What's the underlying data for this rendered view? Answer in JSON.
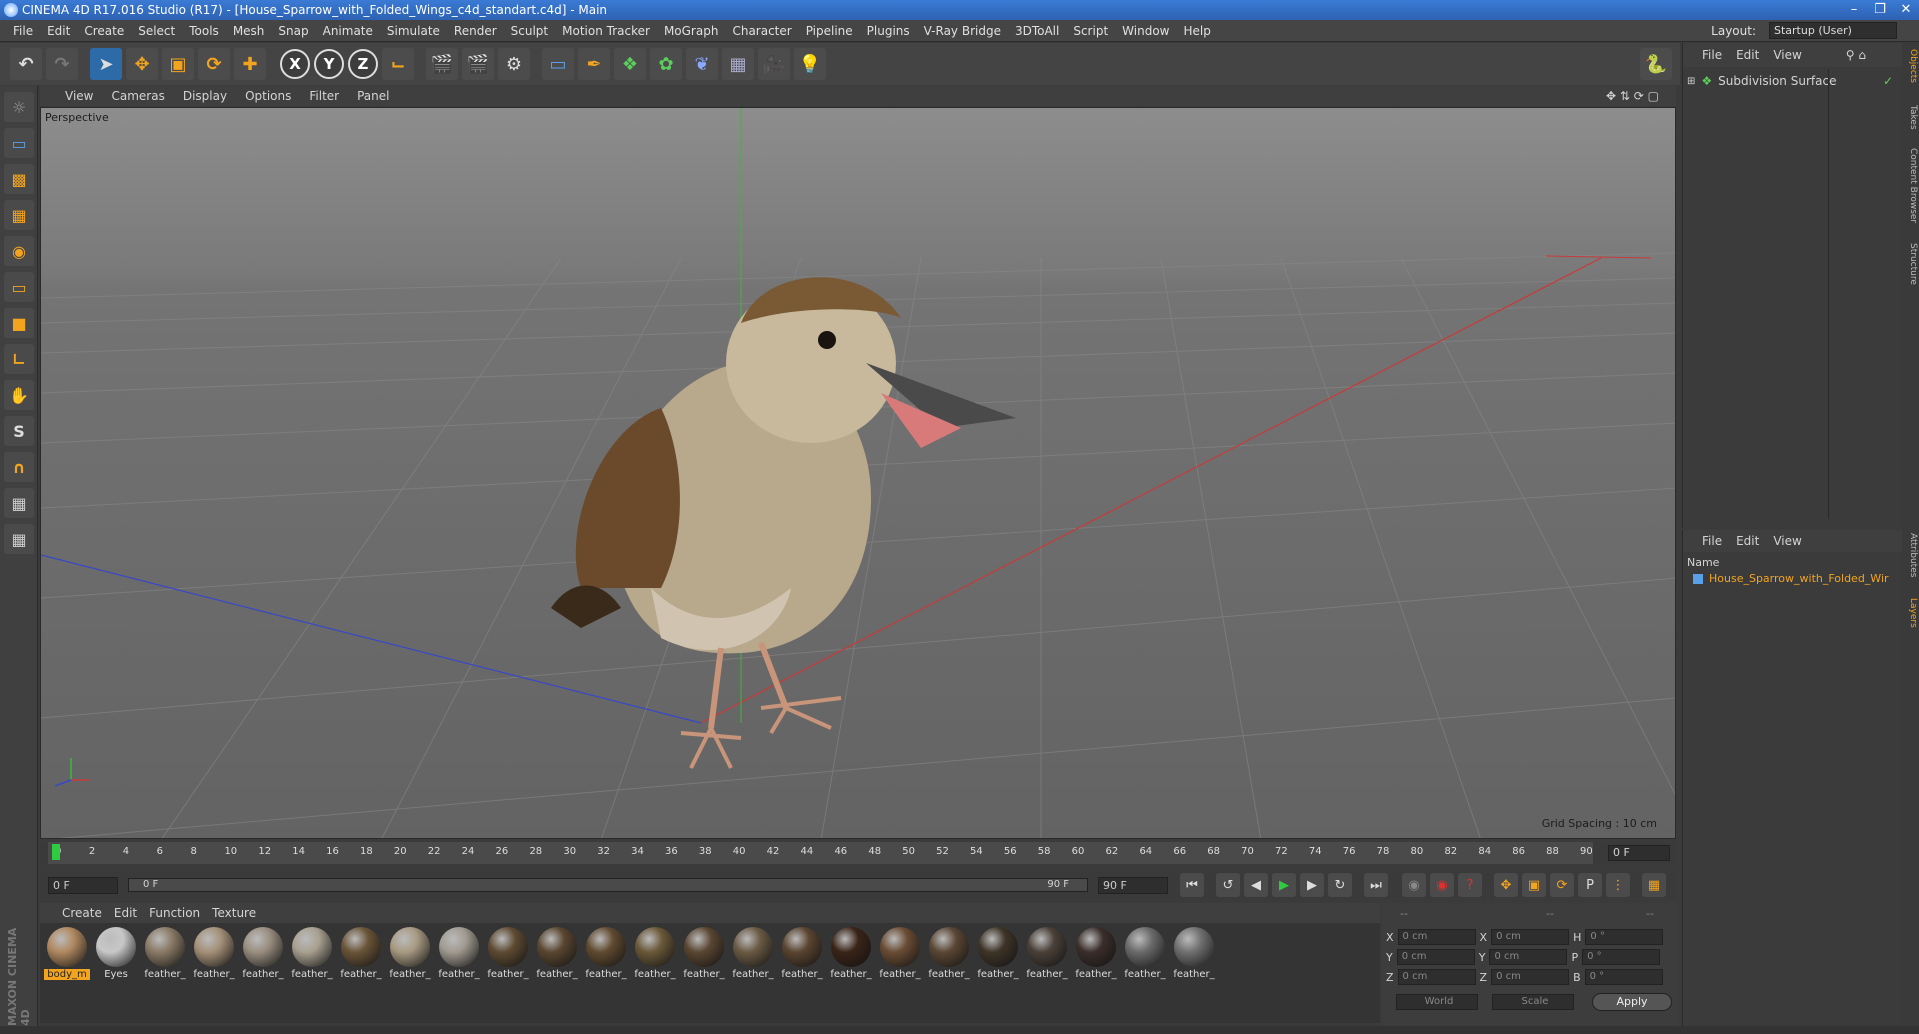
{
  "window": {
    "title": "CINEMA 4D R17.016 Studio (R17) - [House_Sparrow_with_Folded_Wings_c4d_standart.c4d] - Main"
  },
  "menu": [
    "File",
    "Edit",
    "Create",
    "Select",
    "Tools",
    "Mesh",
    "Snap",
    "Animate",
    "Simulate",
    "Render",
    "Sculpt",
    "Motion Tracker",
    "MoGraph",
    "Character",
    "Pipeline",
    "Plugins",
    "V-Ray Bridge",
    "3DToAll",
    "Script",
    "Window",
    "Help"
  ],
  "layout": {
    "label": "Layout:",
    "value": "Startup (User)"
  },
  "viewport": {
    "menu": [
      "View",
      "Cameras",
      "Display",
      "Options",
      "Filter",
      "Panel"
    ],
    "camera_label": "Perspective",
    "grid_spacing": "Grid Spacing : 10 cm"
  },
  "timeline": {
    "ticks": [
      "0",
      "2",
      "4",
      "6",
      "8",
      "10",
      "12",
      "14",
      "16",
      "18",
      "20",
      "22",
      "24",
      "26",
      "28",
      "30",
      "32",
      "34",
      "36",
      "38",
      "40",
      "42",
      "44",
      "46",
      "48",
      "50",
      "52",
      "54",
      "56",
      "58",
      "60",
      "62",
      "64",
      "66",
      "68",
      "70",
      "72",
      "74",
      "76",
      "78",
      "80",
      "82",
      "84",
      "86",
      "88",
      "90"
    ],
    "current_frame": "0 F",
    "start_frame": "0 F",
    "range_start": "0 F",
    "range_end": "90 F",
    "end_frame": "90 F"
  },
  "materials": {
    "menu": [
      "Create",
      "Edit",
      "Function",
      "Texture"
    ],
    "items": [
      {
        "label": "body_m",
        "color": "#b08860"
      },
      {
        "label": "Eyes",
        "color": "#c8c8c8"
      },
      {
        "label": "feather_",
        "color": "#8a7a66"
      },
      {
        "label": "feather_",
        "color": "#a49078"
      },
      {
        "label": "feather_",
        "color": "#9a8e80"
      },
      {
        "label": "feather_",
        "color": "#a8a090"
      },
      {
        "label": "feather_",
        "color": "#6a5438"
      },
      {
        "label": "feather_",
        "color": "#a89a82"
      },
      {
        "label": "feather_",
        "color": "#a09a90"
      },
      {
        "label": "feather_",
        "color": "#5e4a32"
      },
      {
        "label": "feather_",
        "color": "#5a4630"
      },
      {
        "label": "feather_",
        "color": "#604a30"
      },
      {
        "label": "feather_",
        "color": "#6a5838"
      },
      {
        "label": "feather_",
        "color": "#5a4632"
      },
      {
        "label": "feather_",
        "color": "#6a5a44"
      },
      {
        "label": "feather_",
        "color": "#5a4430"
      },
      {
        "label": "feather_",
        "color": "#3a2418"
      },
      {
        "label": "feather_",
        "color": "#6a4c34"
      },
      {
        "label": "feather_",
        "color": "#5a4634"
      },
      {
        "label": "feather_",
        "color": "#3e3428"
      },
      {
        "label": "feather_",
        "color": "#4a4038"
      },
      {
        "label": "feather_",
        "color": "#3a2e2a"
      },
      {
        "label": "feather_",
        "color": "#6a6a6a"
      },
      {
        "label": "feather_",
        "color": "#707070"
      }
    ]
  },
  "coords": {
    "header": [
      "--",
      "--",
      "--"
    ],
    "rows": [
      {
        "a": "X",
        "av": "0 cm",
        "b": "X",
        "bv": "0 cm",
        "c": "H",
        "cv": "0 °"
      },
      {
        "a": "Y",
        "av": "0 cm",
        "b": "Y",
        "bv": "0 cm",
        "c": "P",
        "cv": "0 °"
      },
      {
        "a": "Z",
        "av": "0 cm",
        "b": "Z",
        "bv": "0 cm",
        "c": "B",
        "cv": "0 °"
      }
    ],
    "world": "World",
    "scale": "Scale",
    "apply": "Apply"
  },
  "objects": {
    "menu": [
      "File",
      "Edit",
      "View"
    ],
    "item": "Subdivision Surface"
  },
  "layers": {
    "menu": [
      "File",
      "Edit",
      "View"
    ],
    "header": "Name",
    "item": "House_Sparrow_with_Folded_Wir"
  },
  "sidetabs": [
    "Objects",
    "Takes",
    "Content Browser",
    "Structure",
    "Attributes",
    "Layers"
  ],
  "brand": "MAXON CINEMA 4D",
  "colors": {
    "accent": "#f2a41f",
    "selection": "#2d6aa8",
    "layer_text": "#f2a41f"
  }
}
